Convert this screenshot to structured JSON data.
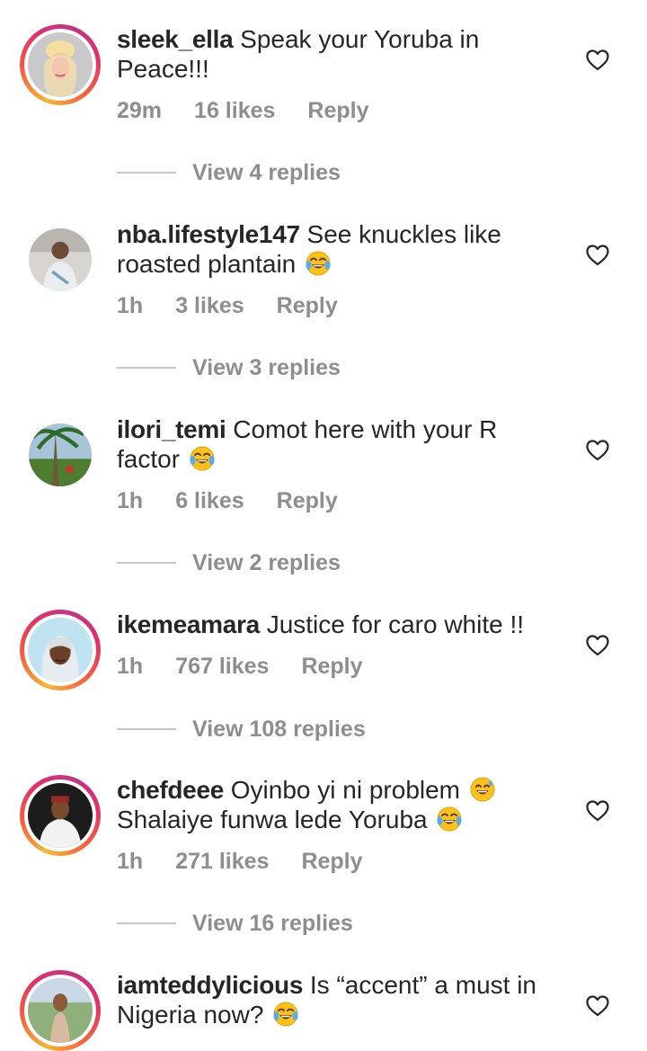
{
  "comments": [
    {
      "username": "sleek_ella",
      "text": "Speak your Yoruba in Peace!!!",
      "time": "29m",
      "likes": "16 likes",
      "reply": "Reply",
      "view_replies": "View 4 replies",
      "story_ring": true
    },
    {
      "username": "nba.lifestyle147",
      "text": "See knuckles like roasted plantain",
      "emoji": "tears-of-joy",
      "time": "1h",
      "likes": "3 likes",
      "reply": "Reply",
      "view_replies": "View 3 replies",
      "story_ring": false
    },
    {
      "username": "ilori_temi",
      "text": "Comot here with your R factor",
      "emoji": "tears-of-joy",
      "time": "1h",
      "likes": "6 likes",
      "reply": "Reply",
      "view_replies": "View 2 replies",
      "story_ring": false
    },
    {
      "username": "ikemeamara",
      "text": "Justice for caro white !!",
      "time": "1h",
      "likes": "767 likes",
      "reply": "Reply",
      "view_replies": "View 108 replies",
      "story_ring": true
    },
    {
      "username": "chefdeee",
      "text_line1": "Oyinbo yi ni problem",
      "text_line2": "Shalaiye funwa lede Yoruba",
      "emoji1": "grinning-sweat",
      "emoji2": "tears-of-joy",
      "time": "1h",
      "likes": "271 likes",
      "reply": "Reply",
      "view_replies": "View 16 replies",
      "story_ring": true
    },
    {
      "username": "iamteddylicious",
      "text": "Is “accent” a must in Nigeria now?",
      "emoji": "tears-of-joy",
      "story_ring": true
    }
  ],
  "icons": {
    "like": "heart-outline-icon"
  },
  "colors": {
    "text": "#262626",
    "secondary": "#8e8e8e",
    "divider": "#c7c7c7"
  }
}
